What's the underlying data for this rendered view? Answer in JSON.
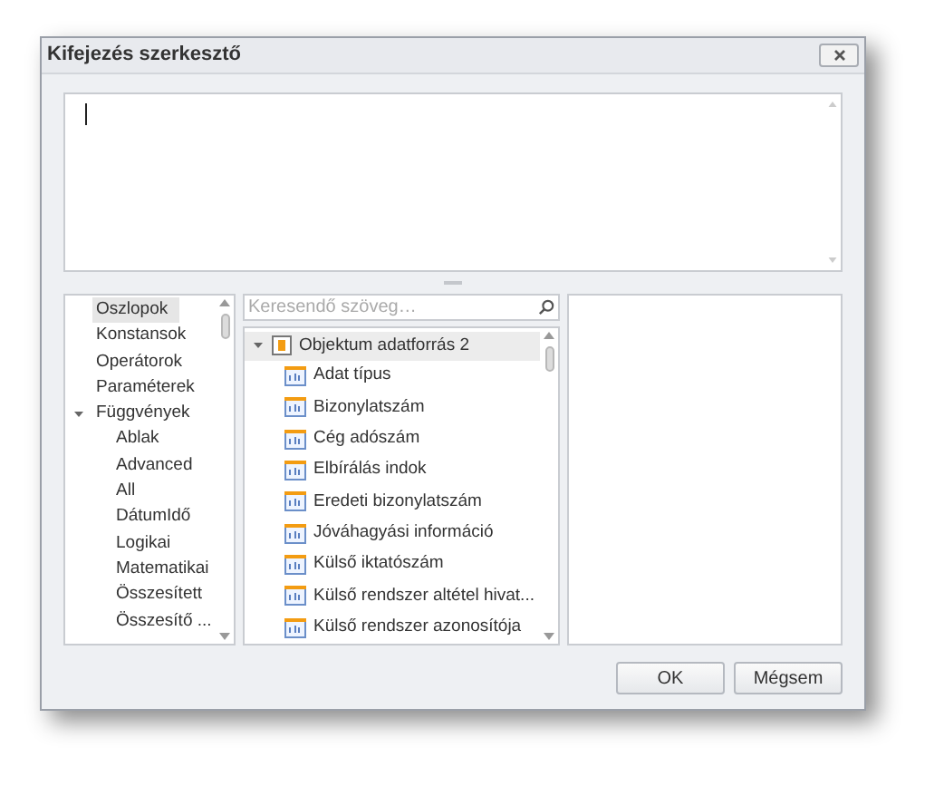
{
  "window": {
    "title": "Kifejezés szerkesztő"
  },
  "categories": [
    {
      "label": "Oszlopok",
      "selected": true
    },
    {
      "label": "Konstansok",
      "selected": false
    },
    {
      "label": "Operátorok",
      "selected": false
    },
    {
      "label": "Paraméterek",
      "selected": false
    },
    {
      "label": "Függvények",
      "selected": false,
      "expanded": true,
      "children": [
        {
          "label": "Ablak",
          "selected": false
        },
        {
          "label": "Advanced",
          "selected": false
        },
        {
          "label": "All",
          "selected": false
        },
        {
          "label": "DátumIdő",
          "selected": false
        },
        {
          "label": "Logikai",
          "selected": false
        },
        {
          "label": "Matematikai",
          "selected": false
        },
        {
          "label": "Összesített",
          "selected": false
        },
        {
          "label": "Összesítő ...",
          "selected": false
        }
      ]
    }
  ],
  "search": {
    "placeholder": "Keresendő szöveg…"
  },
  "fields": {
    "label": "Objektum adatforrás 2",
    "selected": true,
    "expanded": true,
    "children": [
      {
        "label": "Adat típus",
        "selected": false
      },
      {
        "label": "Bizonylatszám",
        "selected": false
      },
      {
        "label": "Cég adószám",
        "selected": false
      },
      {
        "label": "Elbírálás indok",
        "selected": false
      },
      {
        "label": "Eredeti bizonylatszám",
        "selected": false
      },
      {
        "label": "Jóváhagyási információ",
        "selected": false
      },
      {
        "label": "Külső iktatószám",
        "selected": false
      },
      {
        "label": "Külső rendszer altétel hivat...",
        "selected": false
      },
      {
        "label": "Külső rendszer azonosítója",
        "selected": false
      }
    ]
  },
  "buttons": [
    "OK",
    "Mégsem"
  ]
}
